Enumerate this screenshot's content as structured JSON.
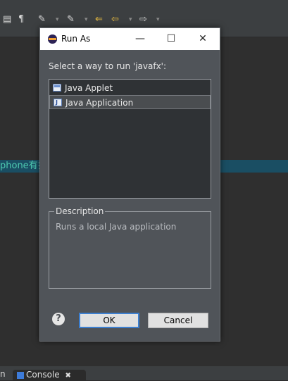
{
  "dialog": {
    "title": "Run As",
    "prompt": "Select a way to run 'javafx':",
    "options": [
      {
        "label": "Java Applet",
        "icon": "java-applet-icon",
        "selected": false
      },
      {
        "label": "Java Application",
        "icon": "java-application-icon",
        "selected": true
      }
    ],
    "description_label": "Description",
    "description_text": "Runs a local Java application",
    "ok_label": "OK",
    "cancel_label": "Cancel",
    "help_symbol": "?",
    "minimize_symbol": "—",
    "maximize_symbol": "☐",
    "close_symbol": "✕"
  },
  "editor": {
    "snippet": "phone有扌"
  },
  "bottom_bar": {
    "left_fragment": "n",
    "console_tab_label": "Console",
    "console_close_symbol": "✖"
  },
  "colors": {
    "dialog_bg": "#505459",
    "accent": "#3c7fd0",
    "highlight_line": "#1a4e63",
    "snippet_text": "#4ec9b0"
  }
}
